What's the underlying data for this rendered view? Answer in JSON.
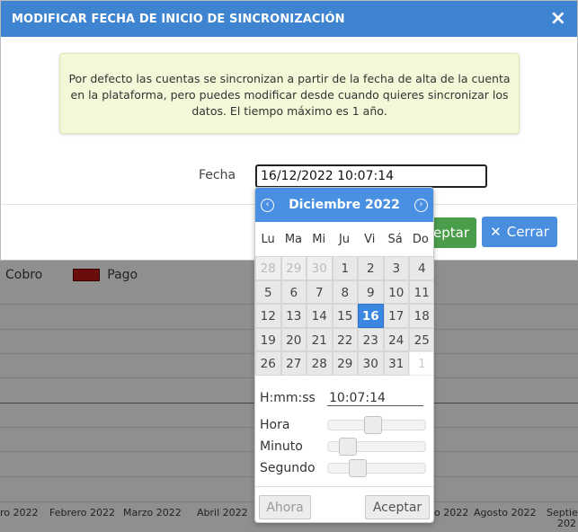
{
  "modal": {
    "title": "MODIFICAR FECHA DE INICIO DE SINCRONIZACIÓN",
    "close_icon": "×",
    "info_text": "Por defecto las cuentas se sincronizan a partir de la fecha de alta de la cuenta en la plataforma, pero puedes modificar desde cuando quieres sincronizar los datos. El tiempo máximo es 1 año.",
    "fecha_label": "Fecha",
    "fecha_value": "16/12/2022 10:07:14",
    "accept_label": "Aceptar",
    "accept_visible": "eptar",
    "close_label": "Cerrar",
    "close_button_icon": "✕"
  },
  "picker": {
    "month": "Diciembre 2022",
    "prev_icon": "‹",
    "next_icon": "›",
    "weekdays": [
      "Lu",
      "Ma",
      "Mi",
      "Ju",
      "Vi",
      "Sá",
      "Do"
    ],
    "days": [
      [
        "28",
        "29",
        "30",
        "1",
        "2",
        "3",
        "4"
      ],
      [
        "5",
        "6",
        "7",
        "8",
        "9",
        "10",
        "11"
      ],
      [
        "12",
        "13",
        "14",
        "15",
        "16",
        "17",
        "18"
      ],
      [
        "19",
        "20",
        "21",
        "22",
        "23",
        "24",
        "25"
      ],
      [
        "26",
        "27",
        "28",
        "29",
        "30",
        "31",
        "1"
      ]
    ],
    "selected_day": "16",
    "time_label": "H:mm:ss",
    "time_value": "10:07:14",
    "hora_label": "Hora",
    "minuto_label": "Minuto",
    "segundo_label": "Segundo",
    "hora_level": 0.4348,
    "minuto_level": 0.1186,
    "segundo_level": 0.2373,
    "ahora_label": "Ahora",
    "aceptar_label": "Aceptar"
  },
  "background_chart": {
    "legend": [
      {
        "label": "Cobro",
        "color": ""
      },
      {
        "label": "Pago",
        "color": "#6a0d0d"
      }
    ],
    "x_labels": [
      "ro 2022",
      "Febrero 2022",
      "Marzo 2022",
      "Abril 2022",
      "o 2022",
      "Agosto 2022",
      "Septie",
      "202"
    ]
  }
}
